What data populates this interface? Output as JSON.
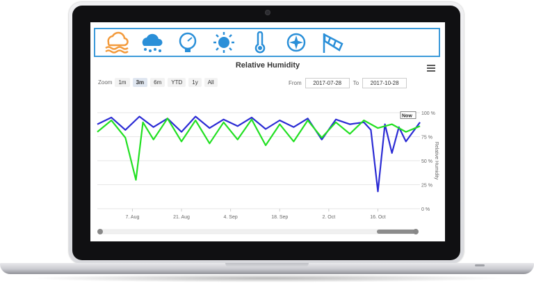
{
  "icons": [
    "weather-rain-wave-icon",
    "rain-cloud-icon",
    "barometer-icon",
    "sun-icon",
    "thermometer-icon",
    "compass-icon",
    "windsock-icon"
  ],
  "colors": {
    "accent": "#3b9ad9",
    "series_blue": "#2b2bd4",
    "series_green": "#22e022",
    "icon_orange": "#f39a3b",
    "icon_blue": "#2a8fd8"
  },
  "toolbar": {
    "zoom_label": "Zoom",
    "zoom_options": [
      "1m",
      "3m",
      "6m",
      "YTD",
      "1y",
      "All"
    ],
    "zoom_selected": "3m",
    "from_label": "From",
    "from_value": "2017-07-28",
    "to_label": "To",
    "to_value": "2017-10-28"
  },
  "chart_data": {
    "type": "line",
    "title": "Relative Humidity",
    "ylabel": "Relative Humidity",
    "ylim": [
      0,
      100
    ],
    "yticks": [
      "100 %",
      "75 %",
      "50 %",
      "25 %",
      "0 %"
    ],
    "xticks": [
      "7. Aug",
      "21. Aug",
      "4. Sep",
      "18. Sep",
      "2. Oct",
      "16. Oct"
    ],
    "xrange": [
      "2017-07-28",
      "2017-10-28"
    ],
    "grid": true,
    "legend": "none",
    "annotation": "Now",
    "series": [
      {
        "color": "#2b2bd4",
        "x": [
          "2017-07-28",
          "2017-08-01",
          "2017-08-05",
          "2017-08-09",
          "2017-08-13",
          "2017-08-17",
          "2017-08-21",
          "2017-08-25",
          "2017-08-29",
          "2017-09-02",
          "2017-09-06",
          "2017-09-10",
          "2017-09-14",
          "2017-09-18",
          "2017-09-22",
          "2017-09-26",
          "2017-09-30",
          "2017-10-04",
          "2017-10-08",
          "2017-10-12",
          "2017-10-14",
          "2017-10-16",
          "2017-10-18",
          "2017-10-20",
          "2017-10-22",
          "2017-10-24",
          "2017-10-28"
        ],
        "y": [
          88,
          95,
          82,
          96,
          85,
          94,
          80,
          96,
          84,
          93,
          86,
          95,
          83,
          92,
          85,
          94,
          72,
          93,
          88,
          90,
          82,
          18,
          88,
          58,
          85,
          70,
          90
        ]
      },
      {
        "color": "#22e022",
        "x": [
          "2017-07-28",
          "2017-08-01",
          "2017-08-05",
          "2017-08-08",
          "2017-08-10",
          "2017-08-13",
          "2017-08-17",
          "2017-08-21",
          "2017-08-25",
          "2017-08-29",
          "2017-09-02",
          "2017-09-06",
          "2017-09-10",
          "2017-09-14",
          "2017-09-18",
          "2017-09-22",
          "2017-09-26",
          "2017-09-30",
          "2017-10-04",
          "2017-10-08",
          "2017-10-12",
          "2017-10-16",
          "2017-10-20",
          "2017-10-24",
          "2017-10-28"
        ],
        "y": [
          80,
          92,
          74,
          30,
          90,
          72,
          94,
          70,
          92,
          68,
          90,
          72,
          93,
          66,
          88,
          70,
          92,
          74,
          90,
          78,
          92,
          84,
          88,
          80,
          86
        ]
      }
    ]
  }
}
